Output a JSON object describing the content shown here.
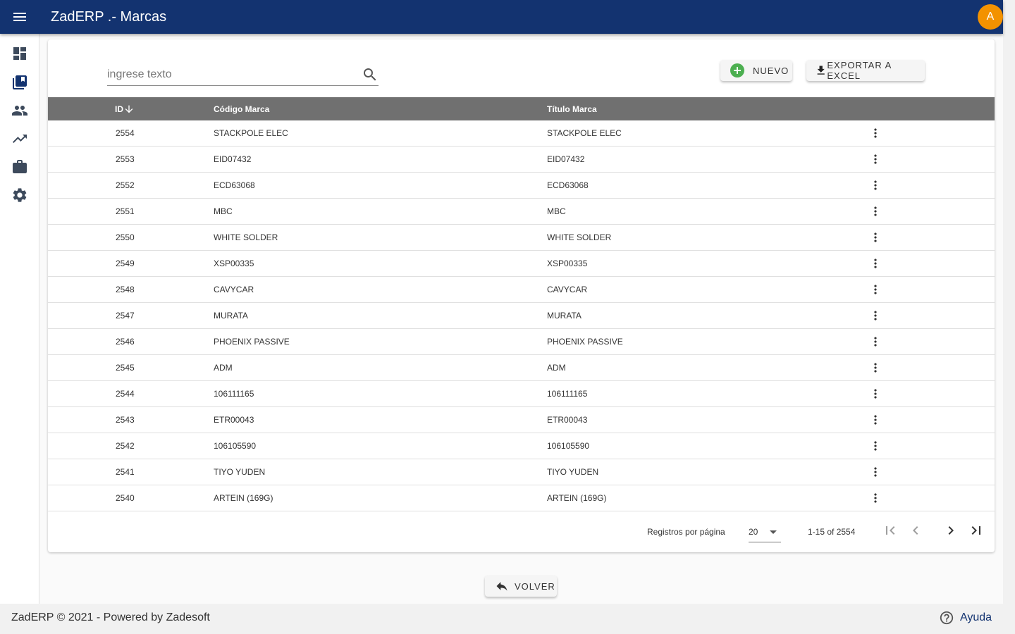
{
  "app": {
    "title": "ZadERP .- Marcas",
    "avatar_letter": "A",
    "brand_color": "#133370",
    "avatar_color": "#f39200"
  },
  "sidebar": {
    "items": [
      {
        "name": "dashboard-icon"
      },
      {
        "name": "library-books-icon"
      },
      {
        "name": "people-icon"
      },
      {
        "name": "trending-up-icon"
      },
      {
        "name": "briefcase-icon"
      },
      {
        "name": "settings-gear-icon"
      }
    ]
  },
  "search": {
    "placeholder": "ingrese texto"
  },
  "toolbar": {
    "new_label": "NUEVO",
    "export_label": "EXPORTAR A EXCEL"
  },
  "table": {
    "headers": {
      "id": "ID",
      "code": "Código Marca",
      "title": "Título Marca"
    },
    "sort": {
      "column": "ID",
      "direction": "descending"
    },
    "rows": [
      {
        "id": "2554",
        "code": "STACKPOLE ELEC",
        "title": "STACKPOLE ELEC"
      },
      {
        "id": "2553",
        "code": "EID07432",
        "title": "EID07432"
      },
      {
        "id": "2552",
        "code": "ECD63068",
        "title": "ECD63068"
      },
      {
        "id": "2551",
        "code": "MBC",
        "title": "MBC"
      },
      {
        "id": "2550",
        "code": "WHITE SOLDER",
        "title": "WHITE SOLDER"
      },
      {
        "id": "2549",
        "code": "XSP00335",
        "title": "XSP00335"
      },
      {
        "id": "2548",
        "code": "CAVYCAR",
        "title": "CAVYCAR"
      },
      {
        "id": "2547",
        "code": "MURATA",
        "title": "MURATA"
      },
      {
        "id": "2546",
        "code": "PHOENIX PASSIVE",
        "title": "PHOENIX PASSIVE"
      },
      {
        "id": "2545",
        "code": "ADM",
        "title": "ADM"
      },
      {
        "id": "2544",
        "code": "106111165",
        "title": "106111165"
      },
      {
        "id": "2543",
        "code": "ETR00043",
        "title": "ETR00043"
      },
      {
        "id": "2542",
        "code": "106105590",
        "title": "106105590"
      },
      {
        "id": "2541",
        "code": "TIYO YUDEN",
        "title": "TIYO YUDEN"
      },
      {
        "id": "2540",
        "code": "ARTEIN (169G)",
        "title": "ARTEIN (169G)"
      }
    ]
  },
  "pagination": {
    "per_page_label": "Registros por página",
    "per_page_value": "20",
    "range_label": "1-15 of 2554"
  },
  "actions": {
    "back_label": "VOLVER"
  },
  "footer": {
    "text": "ZadERP © 2021 - Powered by Zadesoft",
    "help_label": "Ayuda"
  }
}
